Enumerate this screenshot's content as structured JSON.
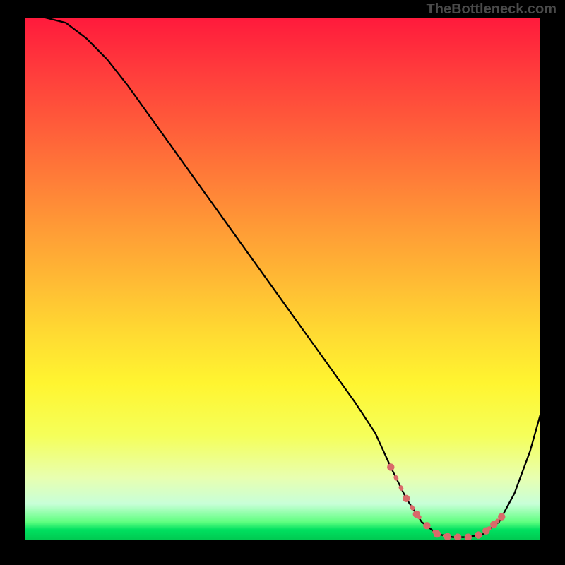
{
  "watermark_text": "TheBottleneck.com",
  "chart_data": {
    "type": "line",
    "title": "",
    "xlabel": "",
    "ylabel": "",
    "xlim": [
      0,
      100
    ],
    "ylim": [
      0,
      100
    ],
    "series": [
      {
        "name": "curve",
        "x": [
          4,
          8,
          12,
          16,
          20,
          24,
          28,
          32,
          36,
          40,
          44,
          48,
          52,
          56,
          60,
          64,
          68,
          71,
          74,
          77,
          80,
          83,
          86,
          89,
          92,
          95,
          98,
          100
        ],
        "y": [
          100,
          99,
          96,
          92,
          87,
          81.5,
          76,
          70.5,
          65,
          59.5,
          54,
          48.5,
          43,
          37.5,
          32,
          26.5,
          20.5,
          14,
          8,
          3.5,
          1.2,
          0.6,
          0.6,
          1.2,
          3.5,
          9,
          17,
          24
        ]
      }
    ],
    "markers": {
      "name": "highlight-points",
      "color": "#d96a6a",
      "x": [
        71,
        74,
        76,
        78,
        80,
        82,
        84,
        86,
        88,
        89.5,
        91,
        92.5
      ],
      "y": [
        14,
        8,
        5,
        2.8,
        1.2,
        0.7,
        0.6,
        0.6,
        1.0,
        1.8,
        3.0,
        4.5
      ]
    }
  }
}
